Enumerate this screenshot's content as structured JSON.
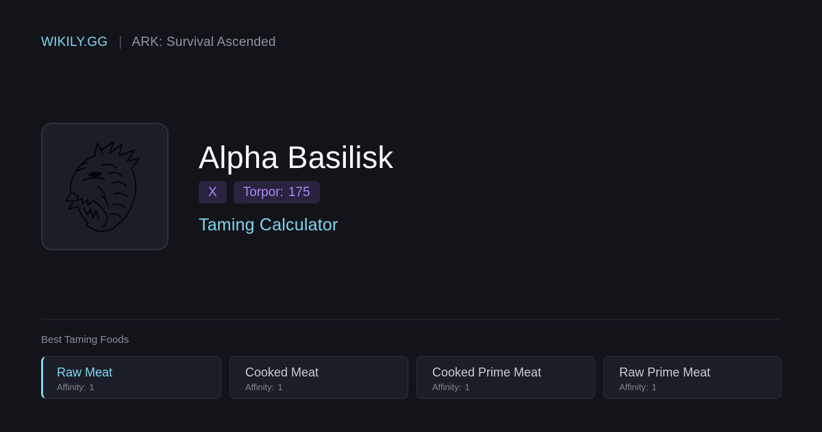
{
  "header": {
    "brand": "WIKILY.GG",
    "separator": "|",
    "game": "ARK: Survival Ascended"
  },
  "creature": {
    "name": "Alpha Basilisk",
    "icon": "basilisk-head-icon",
    "badges": [
      {
        "label": "X",
        "value": ""
      },
      {
        "label": "Torpor:",
        "value": "175"
      }
    ],
    "subtitle": "Taming Calculator"
  },
  "foods": {
    "heading": "Best Taming Foods",
    "affinity_label": "Affinity:",
    "items": [
      {
        "name": "Raw Meat",
        "affinity": "1",
        "active": true
      },
      {
        "name": "Cooked Meat",
        "affinity": "1",
        "active": false
      },
      {
        "name": "Cooked Prime Meat",
        "affinity": "1",
        "active": false
      },
      {
        "name": "Raw Prime Meat",
        "affinity": "1",
        "active": false
      }
    ]
  },
  "colors": {
    "background": "#131419",
    "accent": "#7fd6ef",
    "badge_text": "#a98af0",
    "badge_bg": "#2a2340"
  }
}
